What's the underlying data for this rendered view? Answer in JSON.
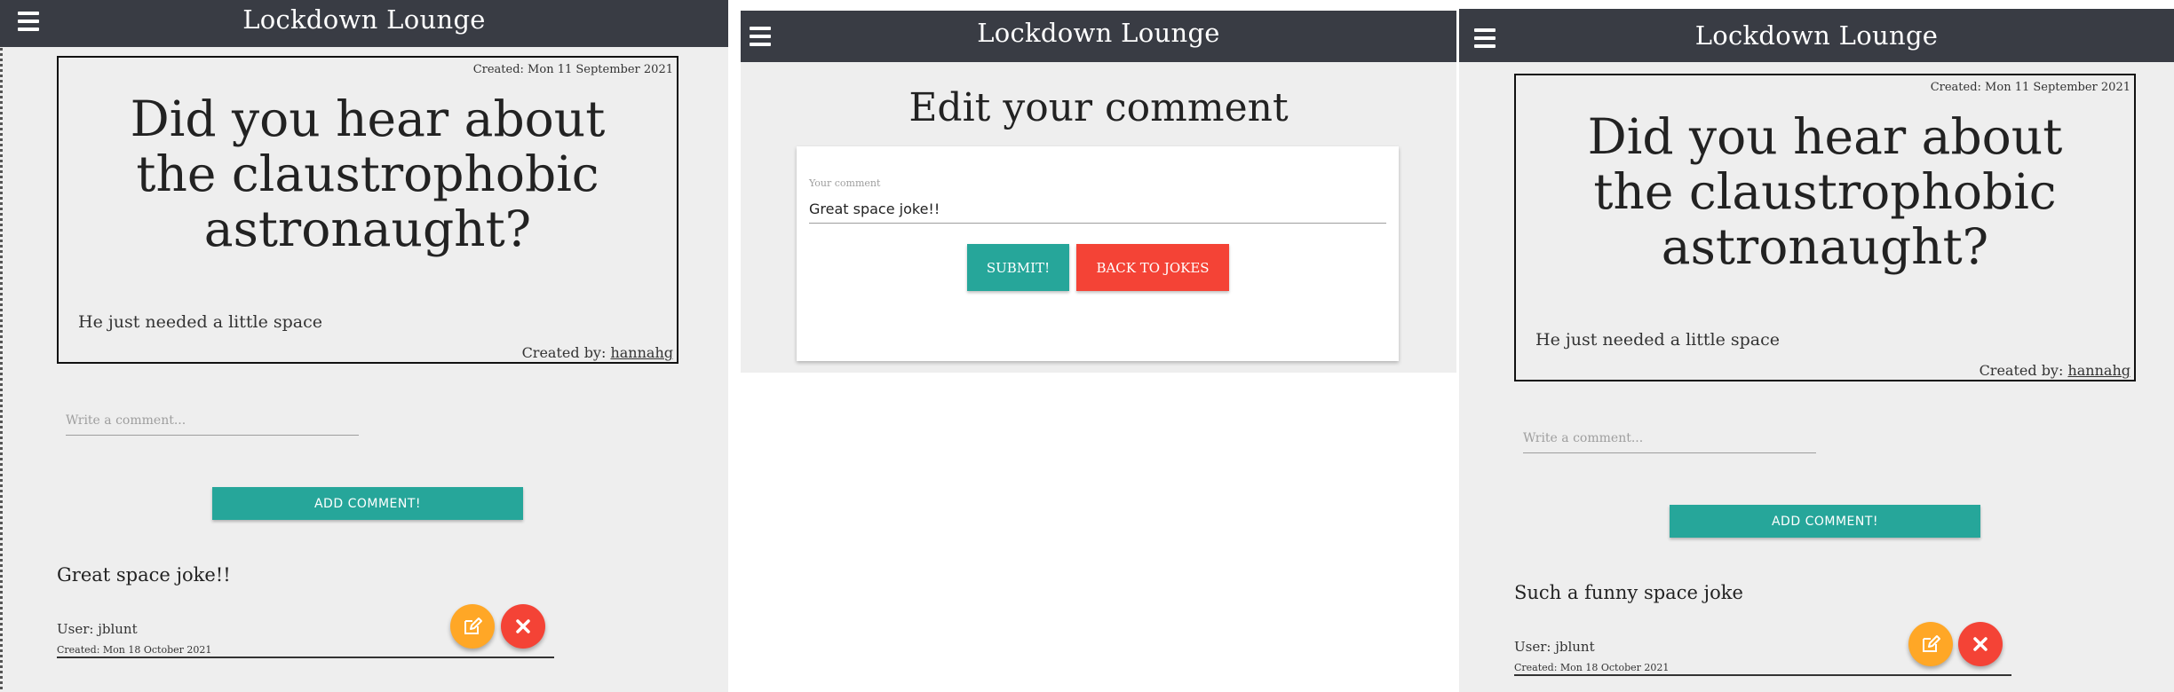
{
  "app": {
    "title": "Lockdown Lounge"
  },
  "joke": {
    "created": "Created: Mon 11 September 2021",
    "question": "Did you hear about the claustrophobic astronaught?",
    "answer": "He just needed a little space",
    "author_label": "Created by: ",
    "author": "hannahg"
  },
  "comment_form": {
    "placeholder": "Write a comment...",
    "add_button": "ADD COMMENT!"
  },
  "left_comment": {
    "text": "Great space joke!!",
    "user": "User: jblunt",
    "created": "Created: Mon 18 October 2021"
  },
  "right_comment": {
    "text": "Such a funny space joke",
    "user": "User: jblunt",
    "created": "Created: Mon 18 October 2021"
  },
  "edit_page": {
    "heading": "Edit your comment",
    "field_label": "Your comment",
    "field_value": "Great space joke!!",
    "submit_button": "SUBMIT!",
    "back_button": "BACK TO JOKES"
  },
  "icons": {
    "menu": "hamburger-menu-icon",
    "edit": "pencil-square-icon",
    "delete": "close-x-icon"
  },
  "colors": {
    "navbar": "#393c44",
    "teal": "#26a69a",
    "red": "#f44336",
    "orange": "#ffa726",
    "background": "#eeeeee"
  }
}
